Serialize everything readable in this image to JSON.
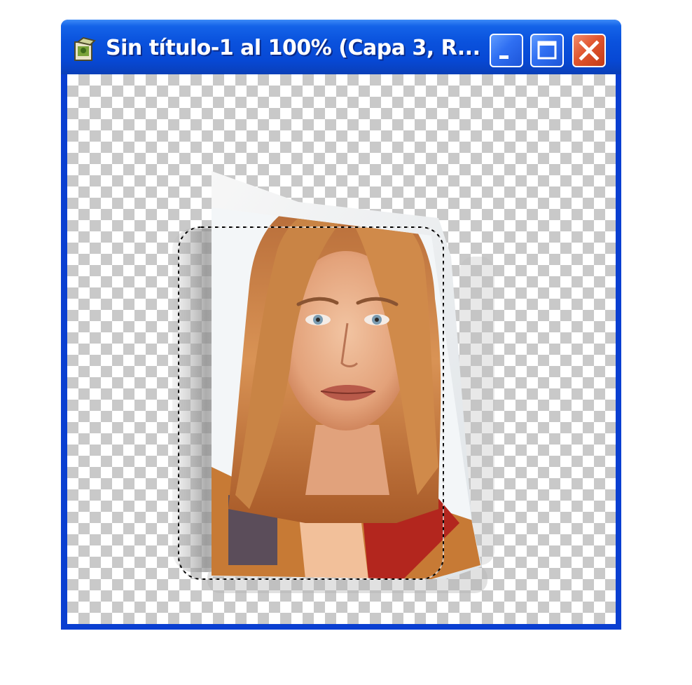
{
  "window": {
    "title": "Sin título-1 al 100% (Capa 3, R...",
    "app_icon": "photoshop-document-icon",
    "controls": {
      "minimize": "minimize-icon",
      "maximize": "maximize-icon",
      "close": "close-icon"
    }
  },
  "canvas": {
    "background": "transparency-checkerboard",
    "layer_content": "portrait-photo-page-curl",
    "selection": "rounded-rectangle-marquee"
  },
  "colors": {
    "titlebar": "#0a52dd",
    "close_button": "#e1552f",
    "checker_dark": "#c9c9c9",
    "checker_light": "#ffffff"
  }
}
